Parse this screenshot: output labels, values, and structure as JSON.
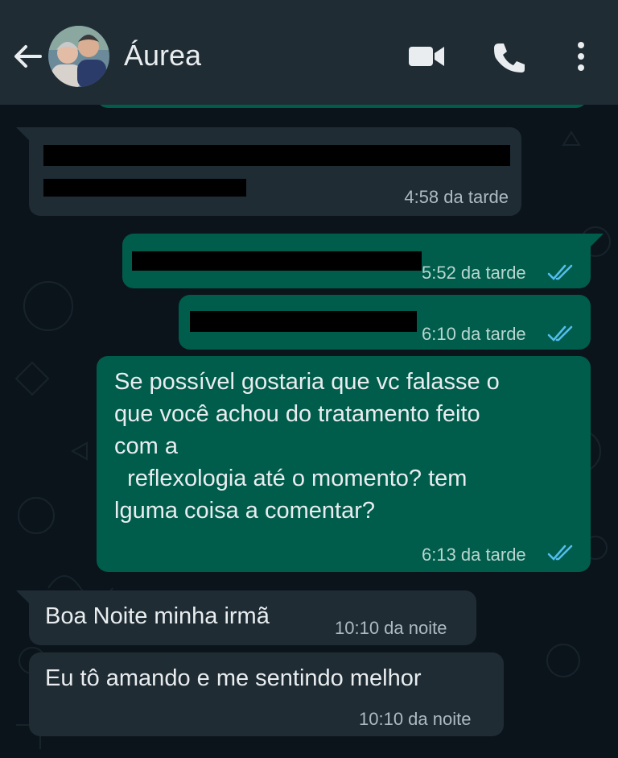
{
  "header": {
    "contact_name": "Áurea",
    "icons": [
      "back-arrow-icon",
      "video-call-icon",
      "voice-call-icon",
      "more-vertical-icon"
    ]
  },
  "messages": [
    {
      "direction": "incoming",
      "text": "",
      "time": "4:58 da tarde",
      "redacted": true
    },
    {
      "direction": "outgoing",
      "text": "",
      "time": "5:52 da tarde",
      "redacted": true,
      "status": "read"
    },
    {
      "direction": "outgoing",
      "text": "",
      "time": "6:10 da tarde",
      "redacted": true,
      "status": "read"
    },
    {
      "direction": "outgoing",
      "lines": [
        "Se possível gostaria que vc falasse o",
        "que você achou do tratamento feito",
        "com a",
        "  reflexologia até o momento? tem",
        "lguma coisa a comentar?"
      ],
      "time": "6:13 da tarde",
      "status": "read"
    },
    {
      "direction": "incoming",
      "text": "Boa Noite minha irmã",
      "time": "10:10 da noite"
    },
    {
      "direction": "incoming",
      "text": "Eu tô amando e me sentindo melhor",
      "time": "10:10 da noite"
    }
  ],
  "colors": {
    "header_bg": "#1f2c34",
    "chat_bg": "#0b141a",
    "incoming_bubble": "#1f2c34",
    "outgoing_bubble": "#005c4b",
    "read_ticks": "#53bdeb"
  }
}
